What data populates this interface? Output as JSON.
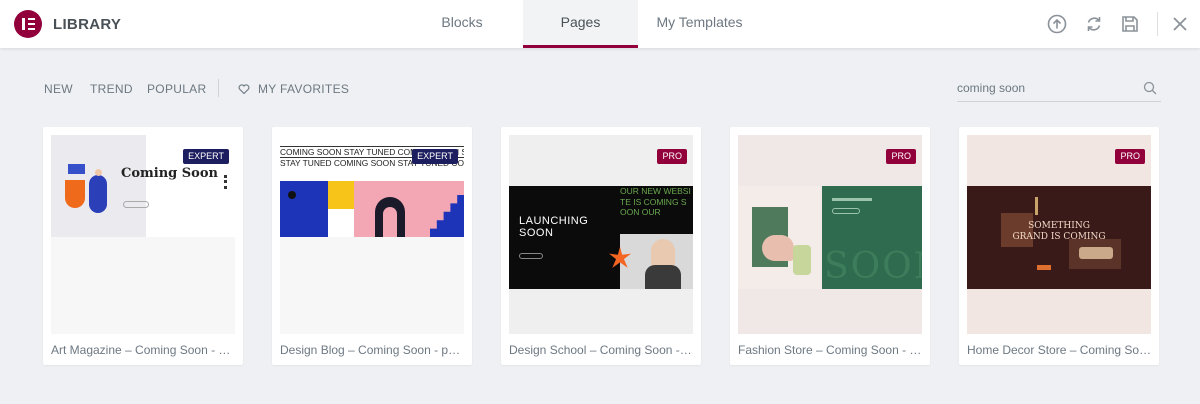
{
  "header": {
    "app_title": "LIBRARY",
    "logo": "elementor-logo",
    "accent": "#92003b",
    "tabs": [
      {
        "label": "Blocks",
        "active": false
      },
      {
        "label": "Pages",
        "active": true
      },
      {
        "label": "My Templates",
        "active": false
      }
    ],
    "icons": [
      "upload-icon",
      "sync-icon",
      "save-icon",
      "close-icon"
    ]
  },
  "filters": {
    "items": [
      "NEW",
      "TREND",
      "POPULAR"
    ],
    "favorites_label": "MY FAVORITES"
  },
  "search": {
    "value": "coming soon"
  },
  "templates": [
    {
      "title": "Art Magazine – Coming Soon - page",
      "badge": "EXPERT",
      "thumb_heading": "Coming Soon"
    },
    {
      "title": "Design Blog – Coming Soon - page",
      "badge": "EXPERT",
      "thumb_marquee": "COMING SOON STAY TUNED COMING SOON STAY TUNED C"
    },
    {
      "title": "Design School – Coming Soon - pa...",
      "badge": "PRO",
      "thumb_heading": "LAUNCHING SOON",
      "thumb_marquee": "OUR NEW WEBSITE IS COMING SOON OUR"
    },
    {
      "title": "Fashion Store – Coming Soon - pa...",
      "badge": "PRO",
      "thumb_heading": "SOON"
    },
    {
      "title": "Home Decor Store – Coming Soon...",
      "badge": "PRO",
      "thumb_heading": "SOMETHING GRAND IS COMING"
    }
  ]
}
